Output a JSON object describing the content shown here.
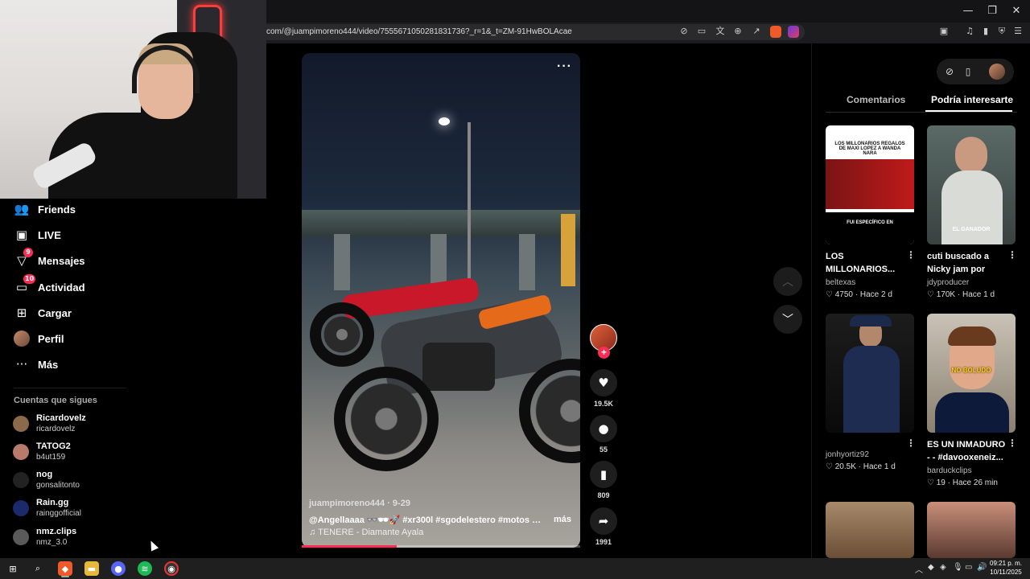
{
  "browser": {
    "url": "com/@juampimoreno444/video/7555671050281831736?_r=1&_t=ZM-91HwBOLAcae",
    "window_controls": [
      "—",
      "❐",
      "✕"
    ],
    "url_icons": [
      "translate-off-icon",
      "cast-icon",
      "translate-icon",
      "zoom-icon",
      "share-icon"
    ],
    "right_icons": [
      "music-icon",
      "battery-icon",
      "sidebar-icon",
      "shield-icon",
      "menu-icon"
    ]
  },
  "sidebar": {
    "items": [
      {
        "label": "Friends",
        "icon": "friends-icon",
        "glyph": "👥"
      },
      {
        "label": "LIVE",
        "icon": "live-icon",
        "glyph": "📺"
      },
      {
        "label": "Mensajes",
        "icon": "messages-icon",
        "glyph": "✈",
        "badge": "9"
      },
      {
        "label": "Actividad",
        "icon": "activity-icon",
        "glyph": "💬",
        "badge": "10"
      },
      {
        "label": "Cargar",
        "icon": "upload-icon",
        "glyph": "⊞"
      },
      {
        "label": "Perfil",
        "icon": "profile-avatar",
        "glyph": ""
      },
      {
        "label": "Más",
        "icon": "more-icon",
        "glyph": "···"
      }
    ],
    "following_title": "Cuentas que sigues",
    "following": [
      {
        "name": "Ricardovelz",
        "handle": "ricardovelz",
        "color": "#8a6a4a"
      },
      {
        "name": "TATOG2",
        "handle": "b4ut159",
        "color": "#b87a6a"
      },
      {
        "name": "nog",
        "handle": "gonsalitonto",
        "color": "#222222"
      },
      {
        "name": "Rain.gg",
        "handle": "rainggofficial",
        "color": "#1a2a6a"
      },
      {
        "name": "nmz.clips",
        "handle": "nmz_3.0",
        "color": "#5a5a5a"
      }
    ]
  },
  "video": {
    "author": "juampimoreno444 · 9-29",
    "caption": "@Angellaaaa 👓🕶🚀 #xr300l #sgodelestero #motos …",
    "more": "más",
    "music": "♫  TENERE - Diamante Ayala",
    "progress": 0.34,
    "more_dots": "···"
  },
  "actions": {
    "likes": "19.5K",
    "comments": "55",
    "saves": "809",
    "shares": "1991"
  },
  "panel": {
    "tabs": [
      {
        "label": "Comentarios",
        "active": false
      },
      {
        "label": "Podría interesarte",
        "active": true
      }
    ],
    "cards": [
      {
        "title": "LOS MILLONARIOS...",
        "author": "beltexas",
        "likes": "♡ 4750 · Hace 2 d",
        "thumb_text": "LOS MILLONARIOS REGALOS DE MAXI LOPEZ A WANDA NARA",
        "thumb_text2": "FUI ESPECÍFICO EN"
      },
      {
        "title": "cuti buscado a Nicky jam por los...",
        "author": "jdyproducer",
        "likes": "♡ 170K · Hace 1 d",
        "thumb_text": "EL GANADOR",
        "thumb_text2": ""
      },
      {
        "title": "",
        "author": "jonhyortiz92",
        "likes": "♡ 20.5K · Hace 1 d",
        "thumb_text": "",
        "thumb_text2": ""
      },
      {
        "title": "ES UN INMADURO - - #davooxeneiz...",
        "author": "barduckclips",
        "likes": "♡ 19 · Hace 26 min",
        "thumb_text": "NO BOLUDO",
        "thumb_text2": ""
      }
    ]
  },
  "taskbar": {
    "time": "09:21 p. m.",
    "date": "10/11/2025"
  }
}
